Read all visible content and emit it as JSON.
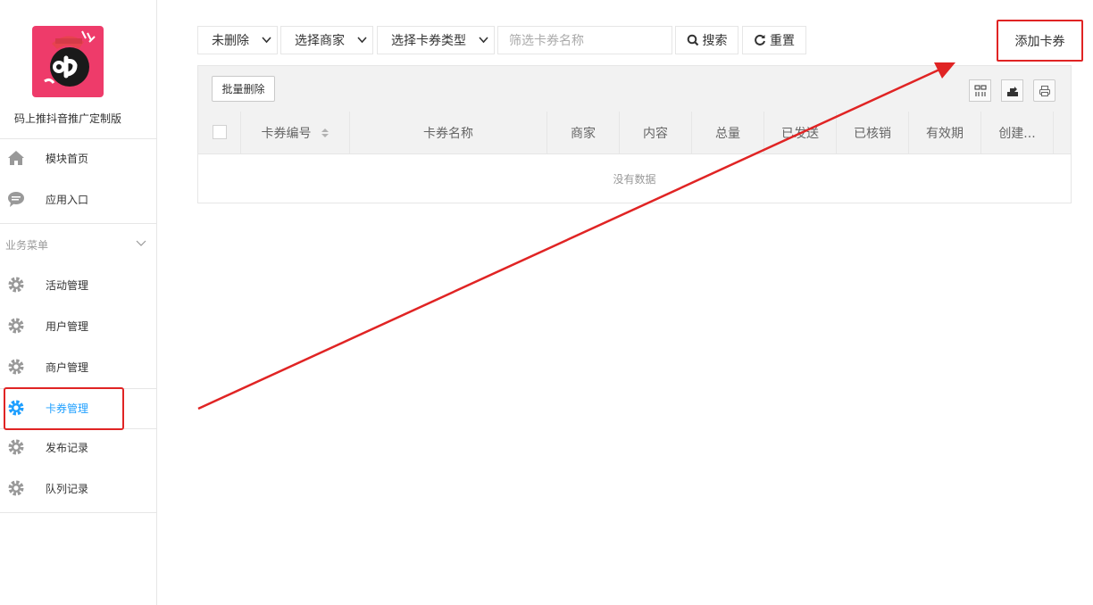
{
  "sidebar": {
    "app_name": "码上推抖音推广定制版",
    "top_items": [
      {
        "label": "模块首页",
        "icon": "home-icon"
      },
      {
        "label": "应用入口",
        "icon": "chat-bubble-icon"
      }
    ],
    "group_title": "业务菜单",
    "menu_items": [
      {
        "label": "活动管理",
        "icon": "gear-icon"
      },
      {
        "label": "用户管理",
        "icon": "gear-icon"
      },
      {
        "label": "商户管理",
        "icon": "gear-icon"
      },
      {
        "label": "卡券管理",
        "icon": "gear-icon",
        "active": true
      },
      {
        "label": "发布记录",
        "icon": "gear-icon"
      },
      {
        "label": "队列记录",
        "icon": "gear-icon"
      }
    ]
  },
  "filters": {
    "status_select": "未删除",
    "merchant_select": "选择商家",
    "coupon_type_select": "选择卡券类型",
    "name_placeholder": "筛选卡券名称",
    "search_label": "搜索",
    "reset_label": "重置"
  },
  "add_button_label": "添加卡券",
  "table": {
    "batch_delete_label": "批量删除",
    "columns": [
      "卡券编号",
      "卡券名称",
      "商家",
      "内容",
      "总量",
      "已发送",
      "已核销",
      "有效期",
      "创建..."
    ],
    "empty_text": "没有数据"
  },
  "colors": {
    "accent": "#1e9fff",
    "annotation_red": "#e02424",
    "logo_bg": "#ee3b6a"
  }
}
